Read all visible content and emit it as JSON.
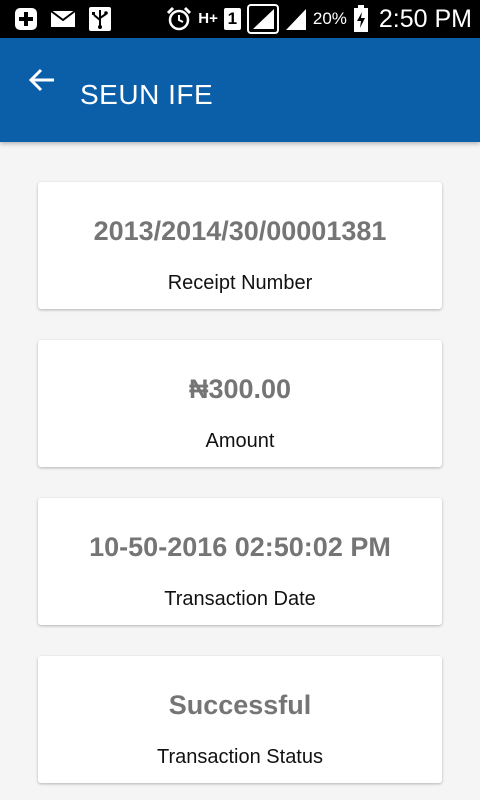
{
  "status_bar": {
    "icons": [
      "add-icon",
      "mail-icon",
      "usb-icon",
      "alarm-icon",
      "hplus-data-icon",
      "sim-1-icon",
      "signal-icon",
      "signal-icon",
      "battery-charging-icon"
    ],
    "network_label": "H+",
    "sim_label": "1",
    "battery_percent": "20%",
    "time": "2:50 PM"
  },
  "app_bar": {
    "title": "SEUN IFE",
    "background_color": "#0b5ea8"
  },
  "cards": {
    "receipt": {
      "value": "2013/2014/30/00001381",
      "label": "Receipt Number"
    },
    "amount": {
      "value": "₦300.00",
      "label": "Amount"
    },
    "date": {
      "value": "10-50-2016 02:50:02 PM",
      "label": "Transaction Date"
    },
    "status": {
      "value": "Successful",
      "label": "Transaction Status"
    }
  },
  "colors": {
    "value_text": "#757575",
    "label_text": "#111111",
    "page_background": "#f5f5f5"
  }
}
